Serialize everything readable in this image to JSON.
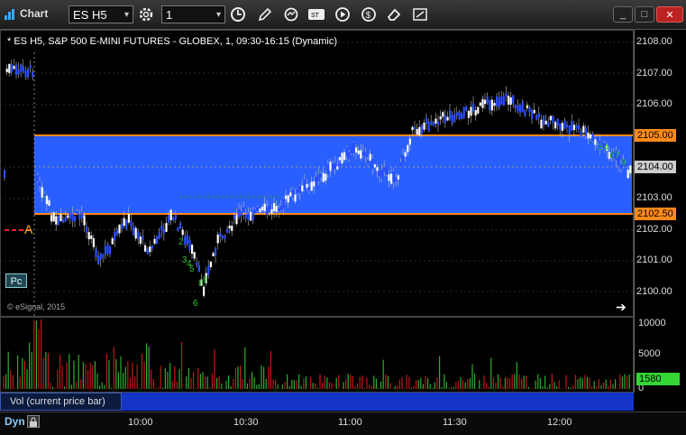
{
  "window": {
    "title": "Chart",
    "symbol": "ES H5",
    "interval": "1"
  },
  "toolbar": {
    "icons": [
      "settings-icon",
      "clock-icon",
      "pencil-icon",
      "refresh-icon",
      "study-icon",
      "play-icon",
      "tag-icon",
      "eraser-icon",
      "toggle-icon"
    ],
    "minimize_label": "_",
    "maximize_label": "□",
    "close_label": "✕"
  },
  "chart": {
    "header": "* ES H5, S&P 500 E-MINI FUTURES - GLOBEX, 1, 09:30-16:15 (Dynamic)",
    "watermark": "© eSignal, 2015",
    "price_labels": [
      "2108.00",
      "2107.00",
      "2106.00",
      "2105.00",
      "2104.00",
      "2103.00",
      "2102.50",
      "2102.00",
      "2101.00",
      "2100.00"
    ],
    "resistance_tag": "2105.00",
    "last_price_tag": "2104.00",
    "support_tag": "2102.50",
    "marker_label": "A",
    "pc_button": "Pc",
    "colors": {
      "zone": "#2a5fff",
      "zone_border": "#ff8a1a",
      "up_candle": "#ffffff",
      "down_candle": "#2a4dff",
      "count_text": "#29c429"
    }
  },
  "volume": {
    "labels": [
      "10000",
      "5000",
      "0"
    ],
    "current_tag": "1580",
    "title": "Vol (current price bar)"
  },
  "time_axis": {
    "dyn_label": "Dyn",
    "labels": [
      "10:00",
      "10:30",
      "11:00",
      "11:30",
      "12:00"
    ]
  }
}
